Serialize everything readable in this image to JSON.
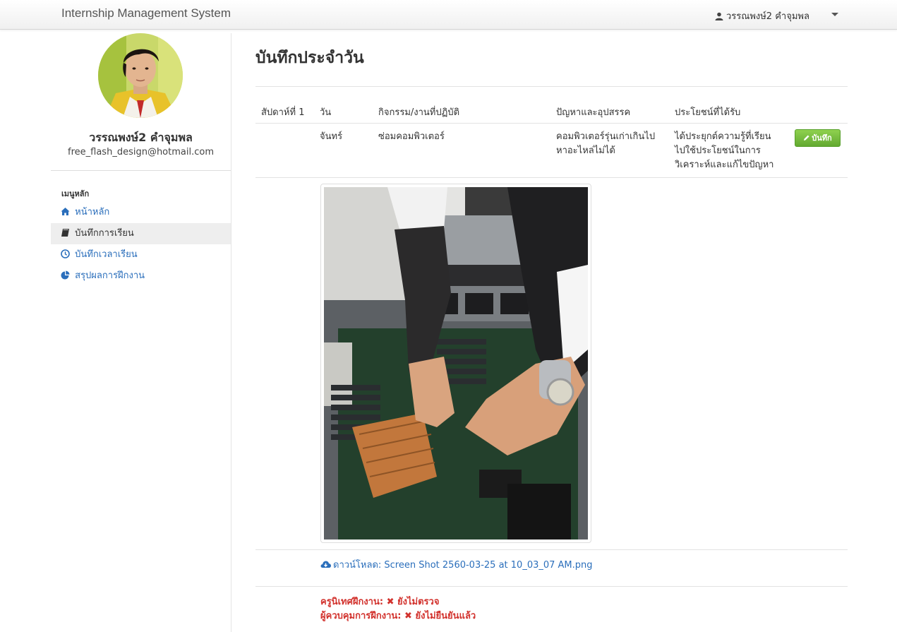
{
  "app": {
    "title": "Internship Management System"
  },
  "user": {
    "name": "วรรณพงษ์2 คำจุมพล",
    "email": "free_flash_design@hotmail.com"
  },
  "menu": {
    "header": "เมนูหลัก",
    "items": [
      {
        "label": "หน้าหลัก",
        "icon": "home-icon"
      },
      {
        "label": "บันทึกการเรียน",
        "icon": "book-icon",
        "active": true
      },
      {
        "label": "บันทึกเวลาเรียน",
        "icon": "clock-icon"
      },
      {
        "label": "สรุปผลการฝึกงาน",
        "icon": "pie-chart-icon"
      }
    ]
  },
  "page": {
    "title": "บันทึกประจำวัน"
  },
  "table": {
    "headers": [
      "สัปดาห์ที่ 1",
      "วัน",
      "กิจกรรม/งานที่ปฏิบัติ",
      "ปัญหาและอุปสรรค",
      "ประโยชน์ที่ได้รับ"
    ],
    "row": {
      "day": "จันทร์",
      "activity": "ซ่อมคอมพิวเตอร์",
      "problem_line1": "คอมพิวเตอร์รุ่นเก่าเกินไป",
      "problem_line2": "หาอะไหล่ไม่ได้",
      "benefit_line1": "ได้ประยุกต์ความรู้ที่เรียน",
      "benefit_line2": "ไปใช้ประโยชน์ในการ",
      "benefit_line3": "วิเคราะห์และแก้ไขปัญหา"
    },
    "save_label": "บันทึก"
  },
  "attachment": {
    "download_label": "ดาวน์โหลด: Screen Shot 2560-03-25 at 10_03_07 AM.png"
  },
  "status": {
    "teacher_label": "ครูนิเทศฝึกงาน:",
    "teacher_value": "ยังไม่ตรวจ",
    "supervisor_label": "ผู้ควบคุมการฝึกงาน:",
    "supervisor_value": "ยังไม่ยืนยันแล้ว"
  },
  "colors": {
    "link": "#2a6ebb",
    "danger": "#d2322d",
    "success": "#62a930"
  }
}
